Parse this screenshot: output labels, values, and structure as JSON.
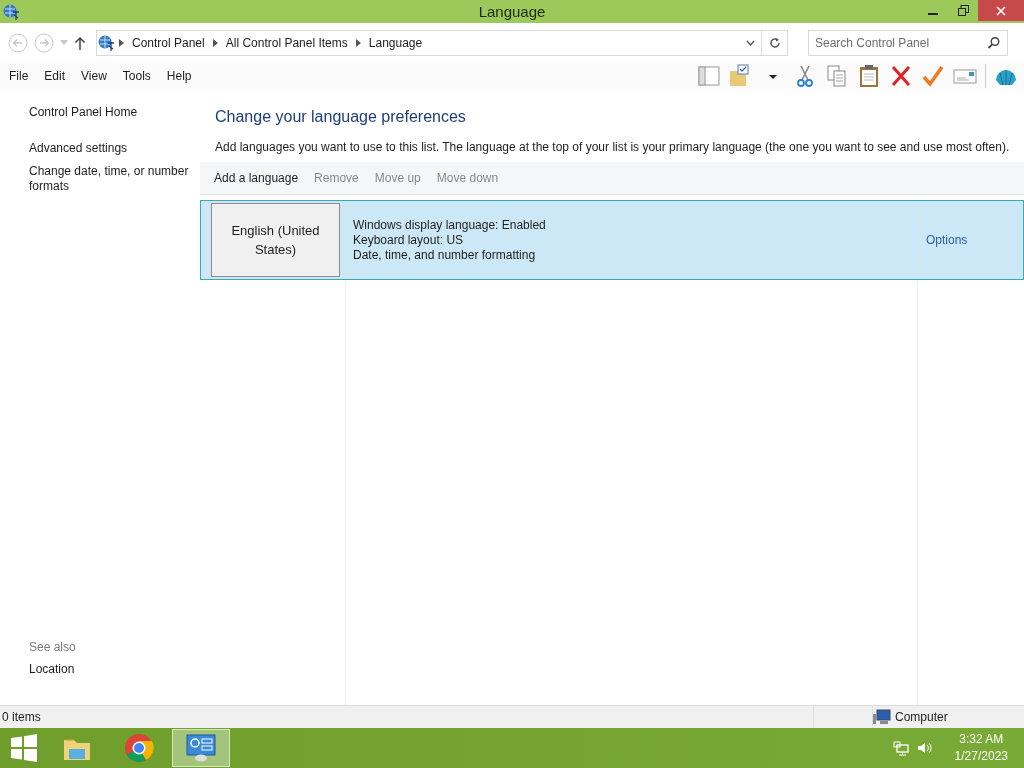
{
  "window": {
    "title": "Language"
  },
  "address_bar": {
    "breadcrumbs": [
      "Control Panel",
      "All Control Panel Items",
      "Language"
    ]
  },
  "search": {
    "placeholder": "Search Control Panel"
  },
  "menu": [
    "File",
    "Edit",
    "View",
    "Tools",
    "Help"
  ],
  "sidebar": {
    "links": [
      "Control Panel Home",
      "Advanced settings",
      "Change date, time, or number formats"
    ],
    "see_also": {
      "heading": "See also",
      "links": [
        "Location"
      ]
    }
  },
  "main": {
    "heading": "Change your language preferences",
    "description": "Add languages you want to use to this list. The language at the top of your list is your primary language (the one you want to see and use most often).",
    "actions": [
      {
        "label": "Add a language",
        "disabled": false
      },
      {
        "label": "Remove",
        "disabled": true
      },
      {
        "label": "Move up",
        "disabled": true
      },
      {
        "label": "Move down",
        "disabled": true
      }
    ],
    "languages": [
      {
        "name": "English (United States)",
        "details": [
          "Windows display language: Enabled",
          "Keyboard layout: US",
          "Date, time, and number formatting"
        ],
        "link": "Options",
        "selected": true
      }
    ]
  },
  "status_bar": {
    "items": "0 items",
    "zone": "Computer"
  },
  "taskbar": {
    "apps": [
      {
        "kind": "explorer",
        "selected": false
      },
      {
        "kind": "chrome",
        "selected": false
      },
      {
        "kind": "control-panel",
        "selected": true
      }
    ],
    "clock": {
      "time": "3:32 AM",
      "date": "1/27/2023"
    }
  }
}
